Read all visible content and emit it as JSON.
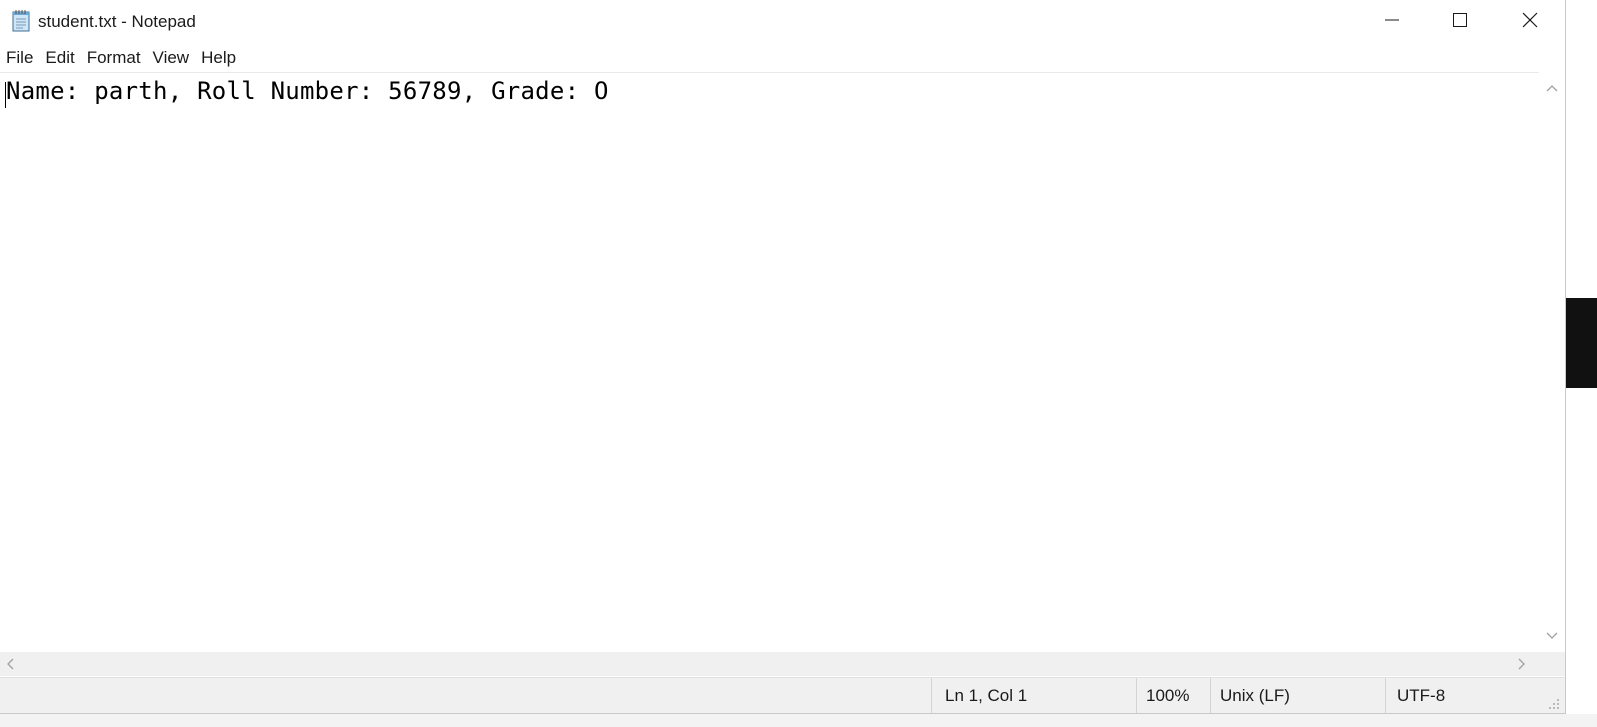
{
  "window": {
    "title": "student.txt - Notepad",
    "icon": "notepad-icon"
  },
  "title_controls": {
    "minimize_icon": "minimize-icon",
    "maximize_icon": "maximize-icon",
    "close_icon": "close-icon"
  },
  "menu": {
    "items": [
      {
        "label": "File"
      },
      {
        "label": "Edit"
      },
      {
        "label": "Format"
      },
      {
        "label": "View"
      },
      {
        "label": "Help"
      }
    ]
  },
  "editor": {
    "content": "Name: parth, Roll Number: 56789, Grade: O"
  },
  "statusbar": {
    "position": "Ln 1, Col 1",
    "zoom": "100%",
    "line_ending": "Unix (LF)",
    "encoding": "UTF-8"
  },
  "colors": {
    "window_bg": "#ffffff",
    "statusbar_bg": "#f0f0f0",
    "text": "#000000"
  }
}
